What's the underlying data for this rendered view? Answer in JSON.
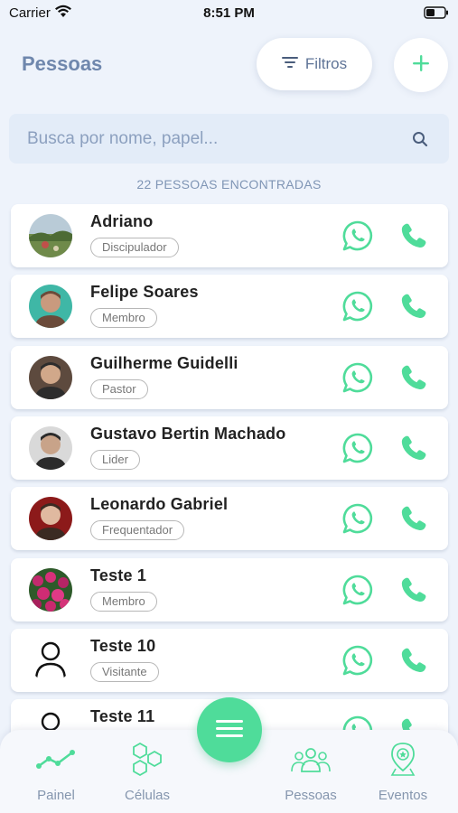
{
  "status_bar": {
    "carrier": "Carrier",
    "time": "8:51 PM"
  },
  "header": {
    "title": "Pessoas",
    "filter_label": "Filtros"
  },
  "search": {
    "placeholder": "Busca por nome, papel..."
  },
  "results_count": "22 PESSOAS ENCONTRADAS",
  "people": [
    {
      "name": "Adriano",
      "role": "Discipulador",
      "avatar": "photo-landscape"
    },
    {
      "name": "Felipe Soares",
      "role": "Membro",
      "avatar": "photo-person"
    },
    {
      "name": "Guilherme Guidelli",
      "role": "Pastor",
      "avatar": "photo-person"
    },
    {
      "name": "Gustavo Bertin Machado",
      "role": "Lider",
      "avatar": "photo-person"
    },
    {
      "name": "Leonardo Gabriel",
      "role": "Frequentador",
      "avatar": "photo-person"
    },
    {
      "name": "Teste 1",
      "role": "Membro",
      "avatar": "photo-flowers"
    },
    {
      "name": "Teste 10",
      "role": "Visitante",
      "avatar": "person-icon"
    },
    {
      "name": "Teste 11",
      "role": "",
      "avatar": "person-icon"
    }
  ],
  "bottom_nav": {
    "items": [
      {
        "label": "Painel",
        "icon": "chart-line-icon"
      },
      {
        "label": "Células",
        "icon": "hexagons-icon"
      },
      {
        "label": "Pessoas",
        "icon": "people-group-icon"
      },
      {
        "label": "Eventos",
        "icon": "location-pin-icon"
      }
    ]
  },
  "colors": {
    "accent_green": "#4fdc9a",
    "title_blue": "#6f87ad",
    "background": "#eef3fb"
  }
}
